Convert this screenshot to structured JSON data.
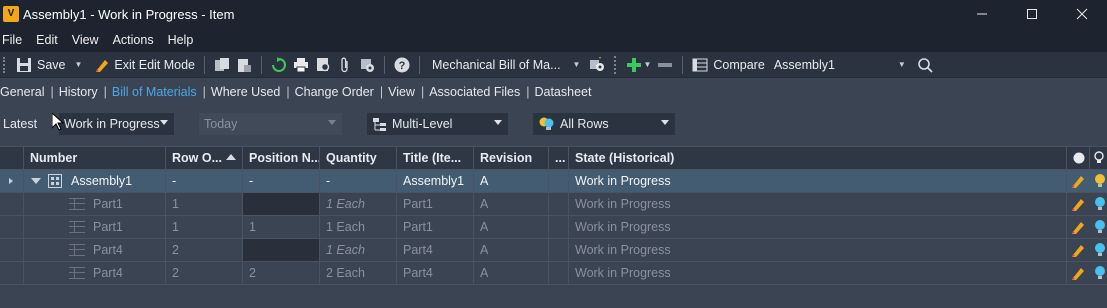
{
  "window": {
    "app_icon_letter": "V",
    "title": "Assembly1 - Work in Progress - Item"
  },
  "menu": [
    "File",
    "Edit",
    "View",
    "Actions",
    "Help"
  ],
  "toolbar": {
    "save_label": "Save",
    "exit_edit_label": "Exit Edit Mode",
    "bom_view_label": "Mechanical Bill of Ma...",
    "compare_label": "Compare",
    "compare_target": "Assembly1"
  },
  "tabs": [
    "General",
    "History",
    "Bill of Materials",
    "Where Used",
    "Change Order",
    "View",
    "Associated Files",
    "Datasheet"
  ],
  "active_tab": "Bill of Materials",
  "filters": {
    "latest_label": "Latest",
    "version": "Work in Progress",
    "date": "Today",
    "level": "Multi-Level",
    "rows": "All Rows"
  },
  "grid": {
    "columns": [
      "Number",
      "Row O...",
      "Position N...",
      "Quantity",
      "Title (Ite...",
      "Revision",
      "...",
      "State (Historical)"
    ],
    "rows": [
      {
        "number": "Assembly1",
        "row_order": "-",
        "position": "-",
        "quantity": "-",
        "title": "Assembly1",
        "revision": "A",
        "state": "Work in Progress"
      },
      {
        "number": "Part1",
        "row_order": "1",
        "position": "",
        "quantity": "1 Each",
        "title": "Part1",
        "revision": "A",
        "state": "Work in Progress"
      },
      {
        "number": "Part1",
        "row_order": "1",
        "position": "1",
        "quantity": "1 Each",
        "title": "Part1",
        "revision": "A",
        "state": "Work in Progress"
      },
      {
        "number": "Part4",
        "row_order": "2",
        "position": "",
        "quantity": "1 Each",
        "title": "Part4",
        "revision": "A",
        "state": "Work in Progress"
      },
      {
        "number": "Part4",
        "row_order": "2",
        "position": "2",
        "quantity": "2 Each",
        "title": "Part4",
        "revision": "A",
        "state": "Work in Progress"
      }
    ]
  },
  "colors": {
    "accent_tab": "#4aa8e8",
    "selected_row": "#445c72",
    "title_bar": "#1d2430",
    "app_icon": "#f0a818",
    "refresh_green": "#3cc85a",
    "add_green": "#3cc85a"
  },
  "icons": [
    "save-icon",
    "pencil-icon",
    "copy-icon",
    "paste-icon",
    "refresh-icon",
    "print-icon",
    "print-preview-icon",
    "attach-icon",
    "settings-print-icon",
    "help-icon",
    "bom-settings-icon",
    "add-icon",
    "remove-icon",
    "compare-icon",
    "search-icon",
    "edit-icon",
    "lightbulb-icon"
  ]
}
